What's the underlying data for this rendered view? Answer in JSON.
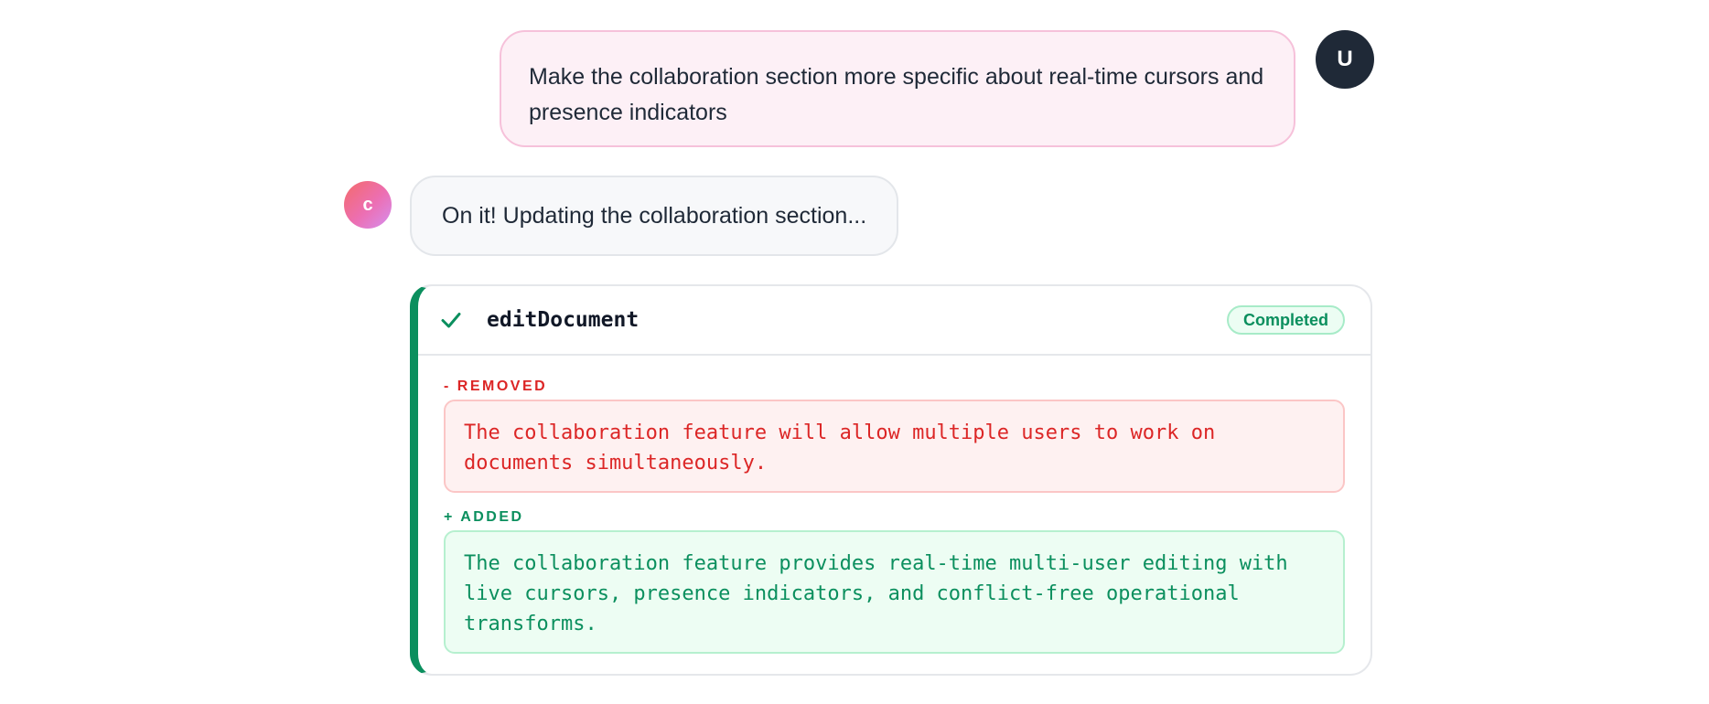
{
  "user_message": {
    "text": "Make the collaboration section more specific about real-time cursors and presence indicators",
    "avatar_initial": "U"
  },
  "assistant_message": {
    "text": "On it! Updating the collaboration section...",
    "avatar_initial": "c"
  },
  "tool_call": {
    "name": "editDocument",
    "status": "Completed",
    "status_icon": "check-icon",
    "removed": {
      "label": "- REMOVED",
      "text": "The collaboration feature will allow multiple users to work on documents simultaneously."
    },
    "added": {
      "label": "+ ADDED",
      "text": "The collaboration feature provides real-time multi-user editing with live cursors, presence indicators, and conflict-free operational transforms."
    }
  },
  "colors": {
    "user_bubble_bg": "#fdf0f6",
    "user_bubble_border": "#f6c1da",
    "user_avatar": "#1f2937",
    "success": "#0b8f5e",
    "removed": "#dc2626"
  }
}
